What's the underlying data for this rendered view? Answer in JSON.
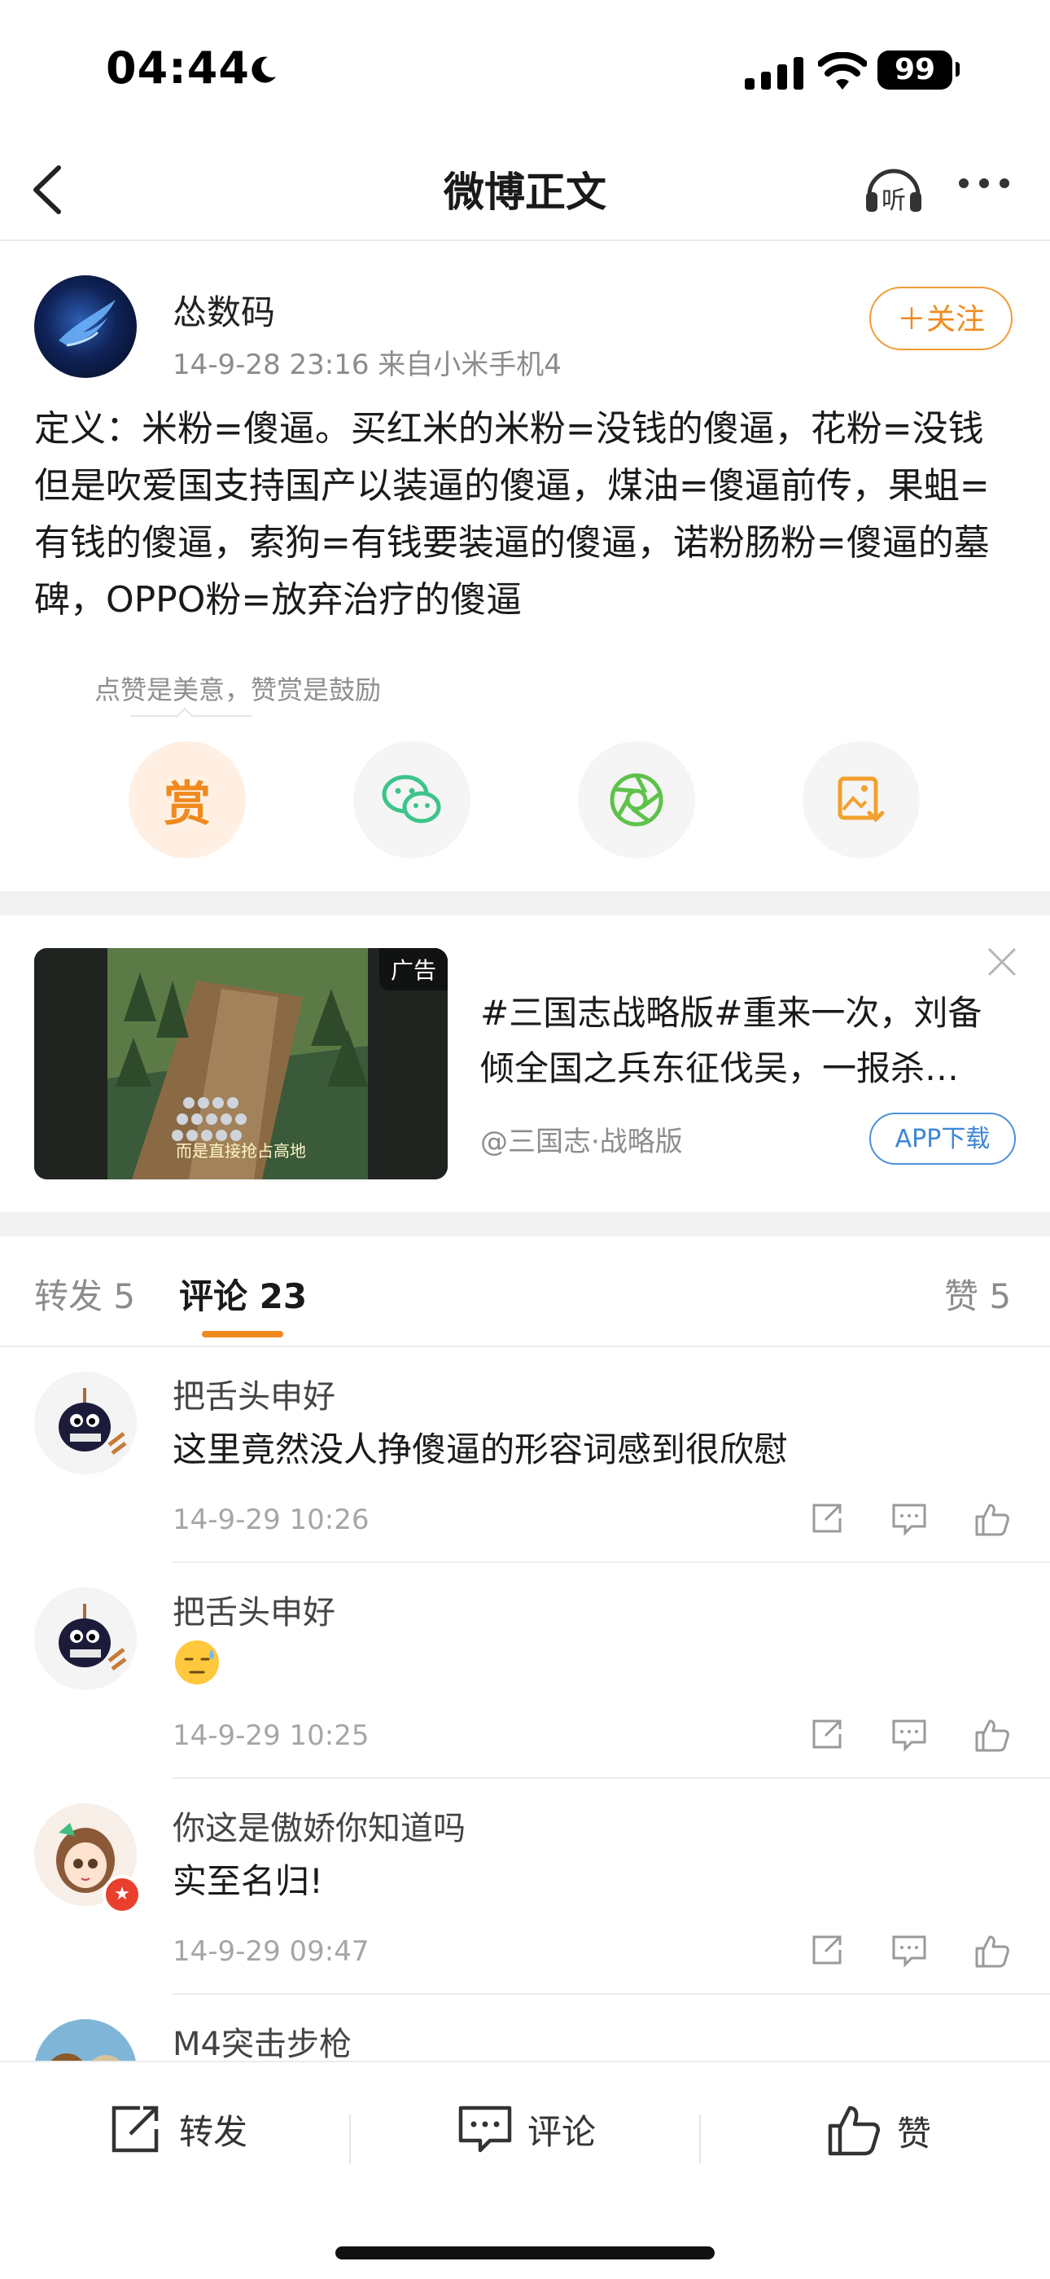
{
  "status": {
    "time": "04:44",
    "battery": "99"
  },
  "nav": {
    "title": "微博正文"
  },
  "post": {
    "author": "怂数码",
    "meta": "14-9-28 23:16  来自小米手机4",
    "follow_label": "＋关注",
    "text": "定义：米粉=傻逼。买红米的米粉=没钱的傻逼，花粉=没钱但是吹爱国支持国产以装逼的傻逼，煤油=傻逼前传，果蛆=有钱的傻逼，索狗=有钱要装逼的傻逼，诺粉肠粉=傻逼的墓碑，OPPO粉=放弃治疗的傻逼",
    "tip": "点赞是美意，赞赏是鼓励",
    "reward_label": "赏"
  },
  "ad": {
    "badge": "广告",
    "caption": "而是直接抢占高地",
    "text": "#三国志战略版#重来一次，刘备倾全国之兵东征伐吴，一报杀…",
    "source": "@三国志·战略版",
    "download_label": "APP下载"
  },
  "tabs": {
    "repost": "转发 5",
    "comments": "评论 23",
    "likes": "赞 5"
  },
  "comments": [
    {
      "name": "把舌头申好",
      "text": "这里竟然没人挣傻逼的形容词感到很欣慰",
      "time": "14-9-29 10:26"
    },
    {
      "name": "把舌头申好",
      "text": "",
      "emoji": "sweat-face",
      "time": "14-9-29 10:25"
    },
    {
      "name": "你这是傲娇你知道吗",
      "text": "实至名归!",
      "time": "14-9-29 09:47"
    },
    {
      "name": "M4突击步枪",
      "text": "",
      "time": ""
    }
  ],
  "toolbar": {
    "repost": "转发",
    "comment": "评论",
    "like": "赞"
  },
  "colors": {
    "accent": "#f08a1e",
    "link": "#3c86d6",
    "wechat": "#3cc48a",
    "moments": "#5ec24a"
  }
}
